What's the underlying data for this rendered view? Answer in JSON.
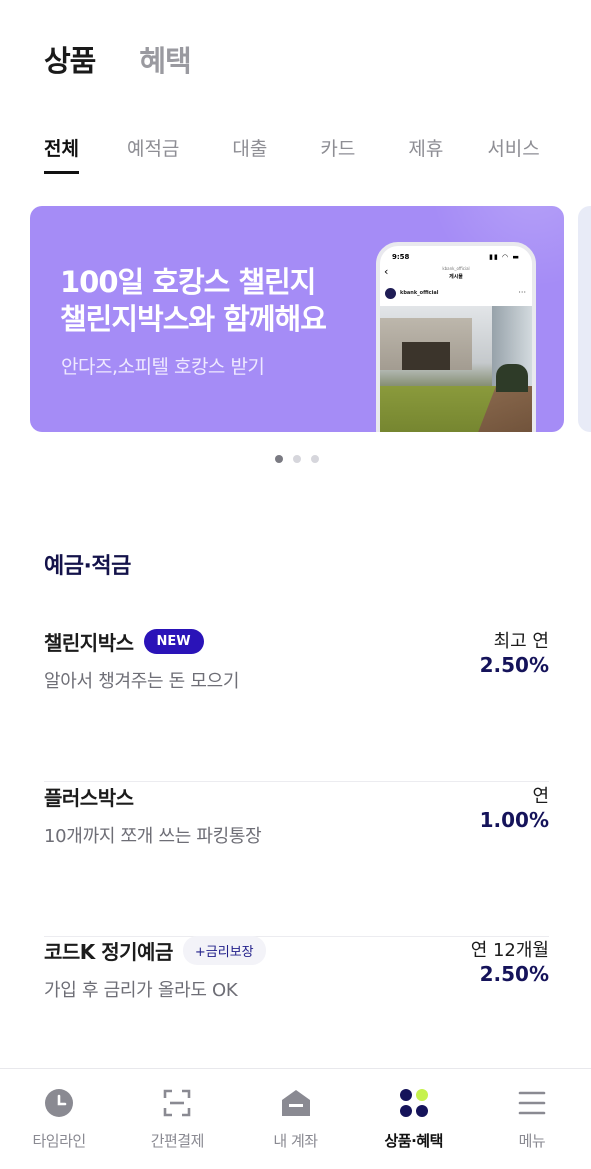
{
  "top_tabs": [
    {
      "label": "상품",
      "active": true
    },
    {
      "label": "혜택",
      "active": false
    }
  ],
  "category_tabs": [
    {
      "label": "전체",
      "active": true
    },
    {
      "label": "예적금",
      "active": false
    },
    {
      "label": "대출",
      "active": false
    },
    {
      "label": "카드",
      "active": false
    },
    {
      "label": "제휴",
      "active": false
    },
    {
      "label": "서비스",
      "active": false
    }
  ],
  "banner": {
    "title_line1": "100일 호캉스 챌린지",
    "title_line2": "챌린지박스와 함께해요",
    "subtitle": "안다즈,소피텔 호캉스 받기",
    "background": "#a58cf6",
    "phone": {
      "time": "9:58",
      "header_top": "kbank_official",
      "header": "게시물",
      "username": "kbank_official"
    },
    "page_count": 3,
    "active_page": 1
  },
  "section": {
    "title": "예금·적금"
  },
  "products": [
    {
      "name": "챌린지박스",
      "badge": "NEW",
      "badge_type": "new",
      "description": "알아서 챙겨주는 돈 모으기",
      "rate_label": "최고 연",
      "rate": "2.50%"
    },
    {
      "name": "플러스박스",
      "badge": "",
      "badge_type": "none",
      "description": "10개까지 쪼개 쓰는 파킹통장",
      "rate_label": "연",
      "rate": "1.00%"
    },
    {
      "name": "코드K 정기예금",
      "badge": "+금리보장",
      "badge_type": "rate",
      "description": "가입 후 금리가 올라도 OK",
      "rate_label": "연 12개월",
      "rate": "2.50%"
    }
  ],
  "bottom_nav": [
    {
      "label": "타임라인",
      "icon": "clock-icon",
      "active": false
    },
    {
      "label": "간편결제",
      "icon": "scan-icon",
      "active": false
    },
    {
      "label": "내 계좌",
      "icon": "home-wallet-icon",
      "active": false
    },
    {
      "label": "상품·혜택",
      "icon": "four-dots-icon",
      "active": true
    },
    {
      "label": "메뉴",
      "icon": "hamburger-menu-icon",
      "active": false
    }
  ],
  "colors": {
    "accent": "#2a13b8",
    "navy": "#15135a",
    "lime": "#c6f24d",
    "banner": "#a58cf6"
  }
}
